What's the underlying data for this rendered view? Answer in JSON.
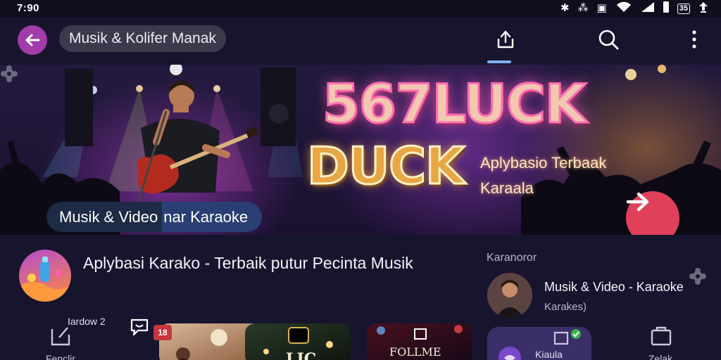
{
  "status_bar": {
    "time": "7:90",
    "battery_text": "35"
  },
  "app_bar": {
    "title": "Musik & Kolifer Manak",
    "icons": [
      "back-arrow-icon",
      "share-icon",
      "search-icon",
      "more-vert-icon"
    ]
  },
  "hero": {
    "title_line1": "567LUCK",
    "title_line2": "DUCK",
    "subtitle_line1": "Aplybasio Terbaak",
    "subtitle_line2": "Karaala",
    "chip_left": "Musik & Video",
    "chip_right": "nar Karaoke"
  },
  "content": {
    "app_title": "Aplybasi Karako - Terbaik putur Pecinta Musik",
    "side_label": "Karanoror",
    "side_title": "Musik & Video - Karaoke",
    "side_subtitle": "Karakes)"
  },
  "bottom": {
    "small_label": "Iardow 2",
    "badge_text": "18",
    "nav_left_label": "Fenclir",
    "nav_mid_label": "Kiaula",
    "nav_right_label": "Zelak",
    "thumb3_text": "FOLLME",
    "thumb2_text": "LIC"
  },
  "colors": {
    "background": "#17152e",
    "back_button": "#a23ca8",
    "next_button": "#e0405a",
    "tab_indicator": "#7fb0f0"
  }
}
